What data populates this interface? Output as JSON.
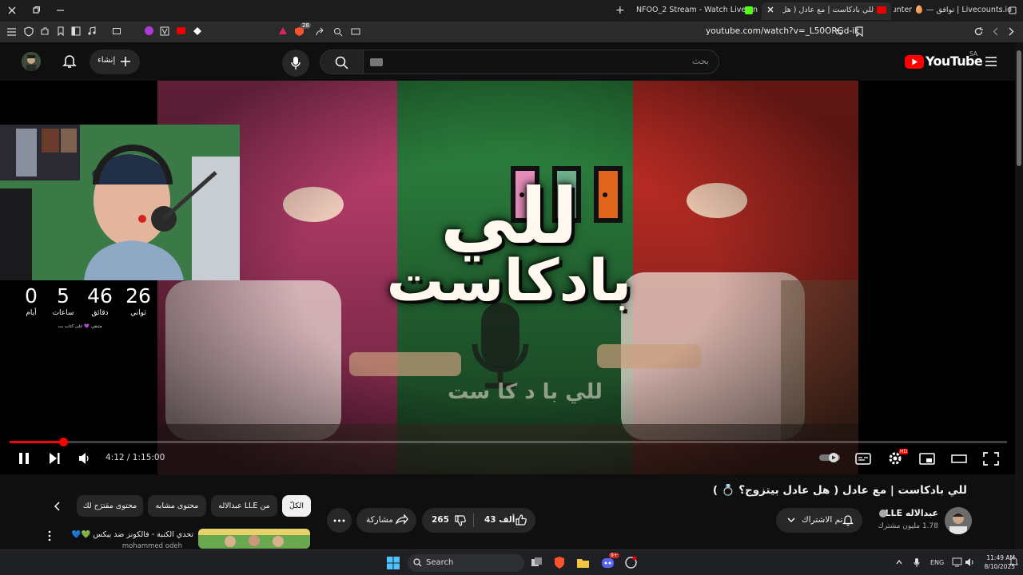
{
  "browser": {
    "tabs": [
      {
        "label": "Livecounts.io | توافق — 🥚 Counter"
      },
      {
        "label": "للي بادكاست | مع عادل ( هل عادل"
      },
      {
        "label": "NFOO_2 Stream - Watch Live on Kick"
      }
    ],
    "new_tab": "+",
    "url": "youtube.com/watch?v=_L50ORGd-ik",
    "extension_badge": "28"
  },
  "youtube": {
    "logo_text": "YouTube",
    "region": "SA",
    "search_placeholder": "بحث",
    "create_label": "إنشاء"
  },
  "video": {
    "thumb_title_line1": "للي",
    "thumb_title_line2": "بادكاست",
    "thumb_subtitle": "للي  با د  كا ست",
    "time_text": "4:12 / 1:15:00",
    "progress_fraction": 0.054,
    "hd_badge": "HD"
  },
  "countdown": {
    "units": [
      {
        "value": "0",
        "label": "أيام"
      },
      {
        "value": "5",
        "label": "ساعات"
      },
      {
        "value": "46",
        "label": "دقائق"
      },
      {
        "value": "26",
        "label": "ثواني"
      }
    ],
    "caption": "متبقي 💜 على كتاب بت"
  },
  "below": {
    "title": "للي بادكاست | مع عادل ( هل عادل بيتزوج؟ 💍 )",
    "channel_name": "عبدالاله LLE",
    "subscribers": "1.78 مليون مشترك",
    "subscribed_label": "تم الاشتراك",
    "likes": "43 ألف",
    "dislikes": "265",
    "share_label": "مشاركة",
    "chips": [
      "الكلّ",
      "من LLE عبدالاله",
      "محتوى مشابه",
      "محتوى مقترَح لك"
    ],
    "rec_title": "تحدي الكنبة - فالكونز ضد بيكس 💚💙",
    "rec_channel": "mohammed odeh"
  },
  "taskbar": {
    "search_label": "Search",
    "lang": "ENG",
    "time": "11:49 AM",
    "date": "8/10/2025",
    "discord_badge": "9+"
  }
}
